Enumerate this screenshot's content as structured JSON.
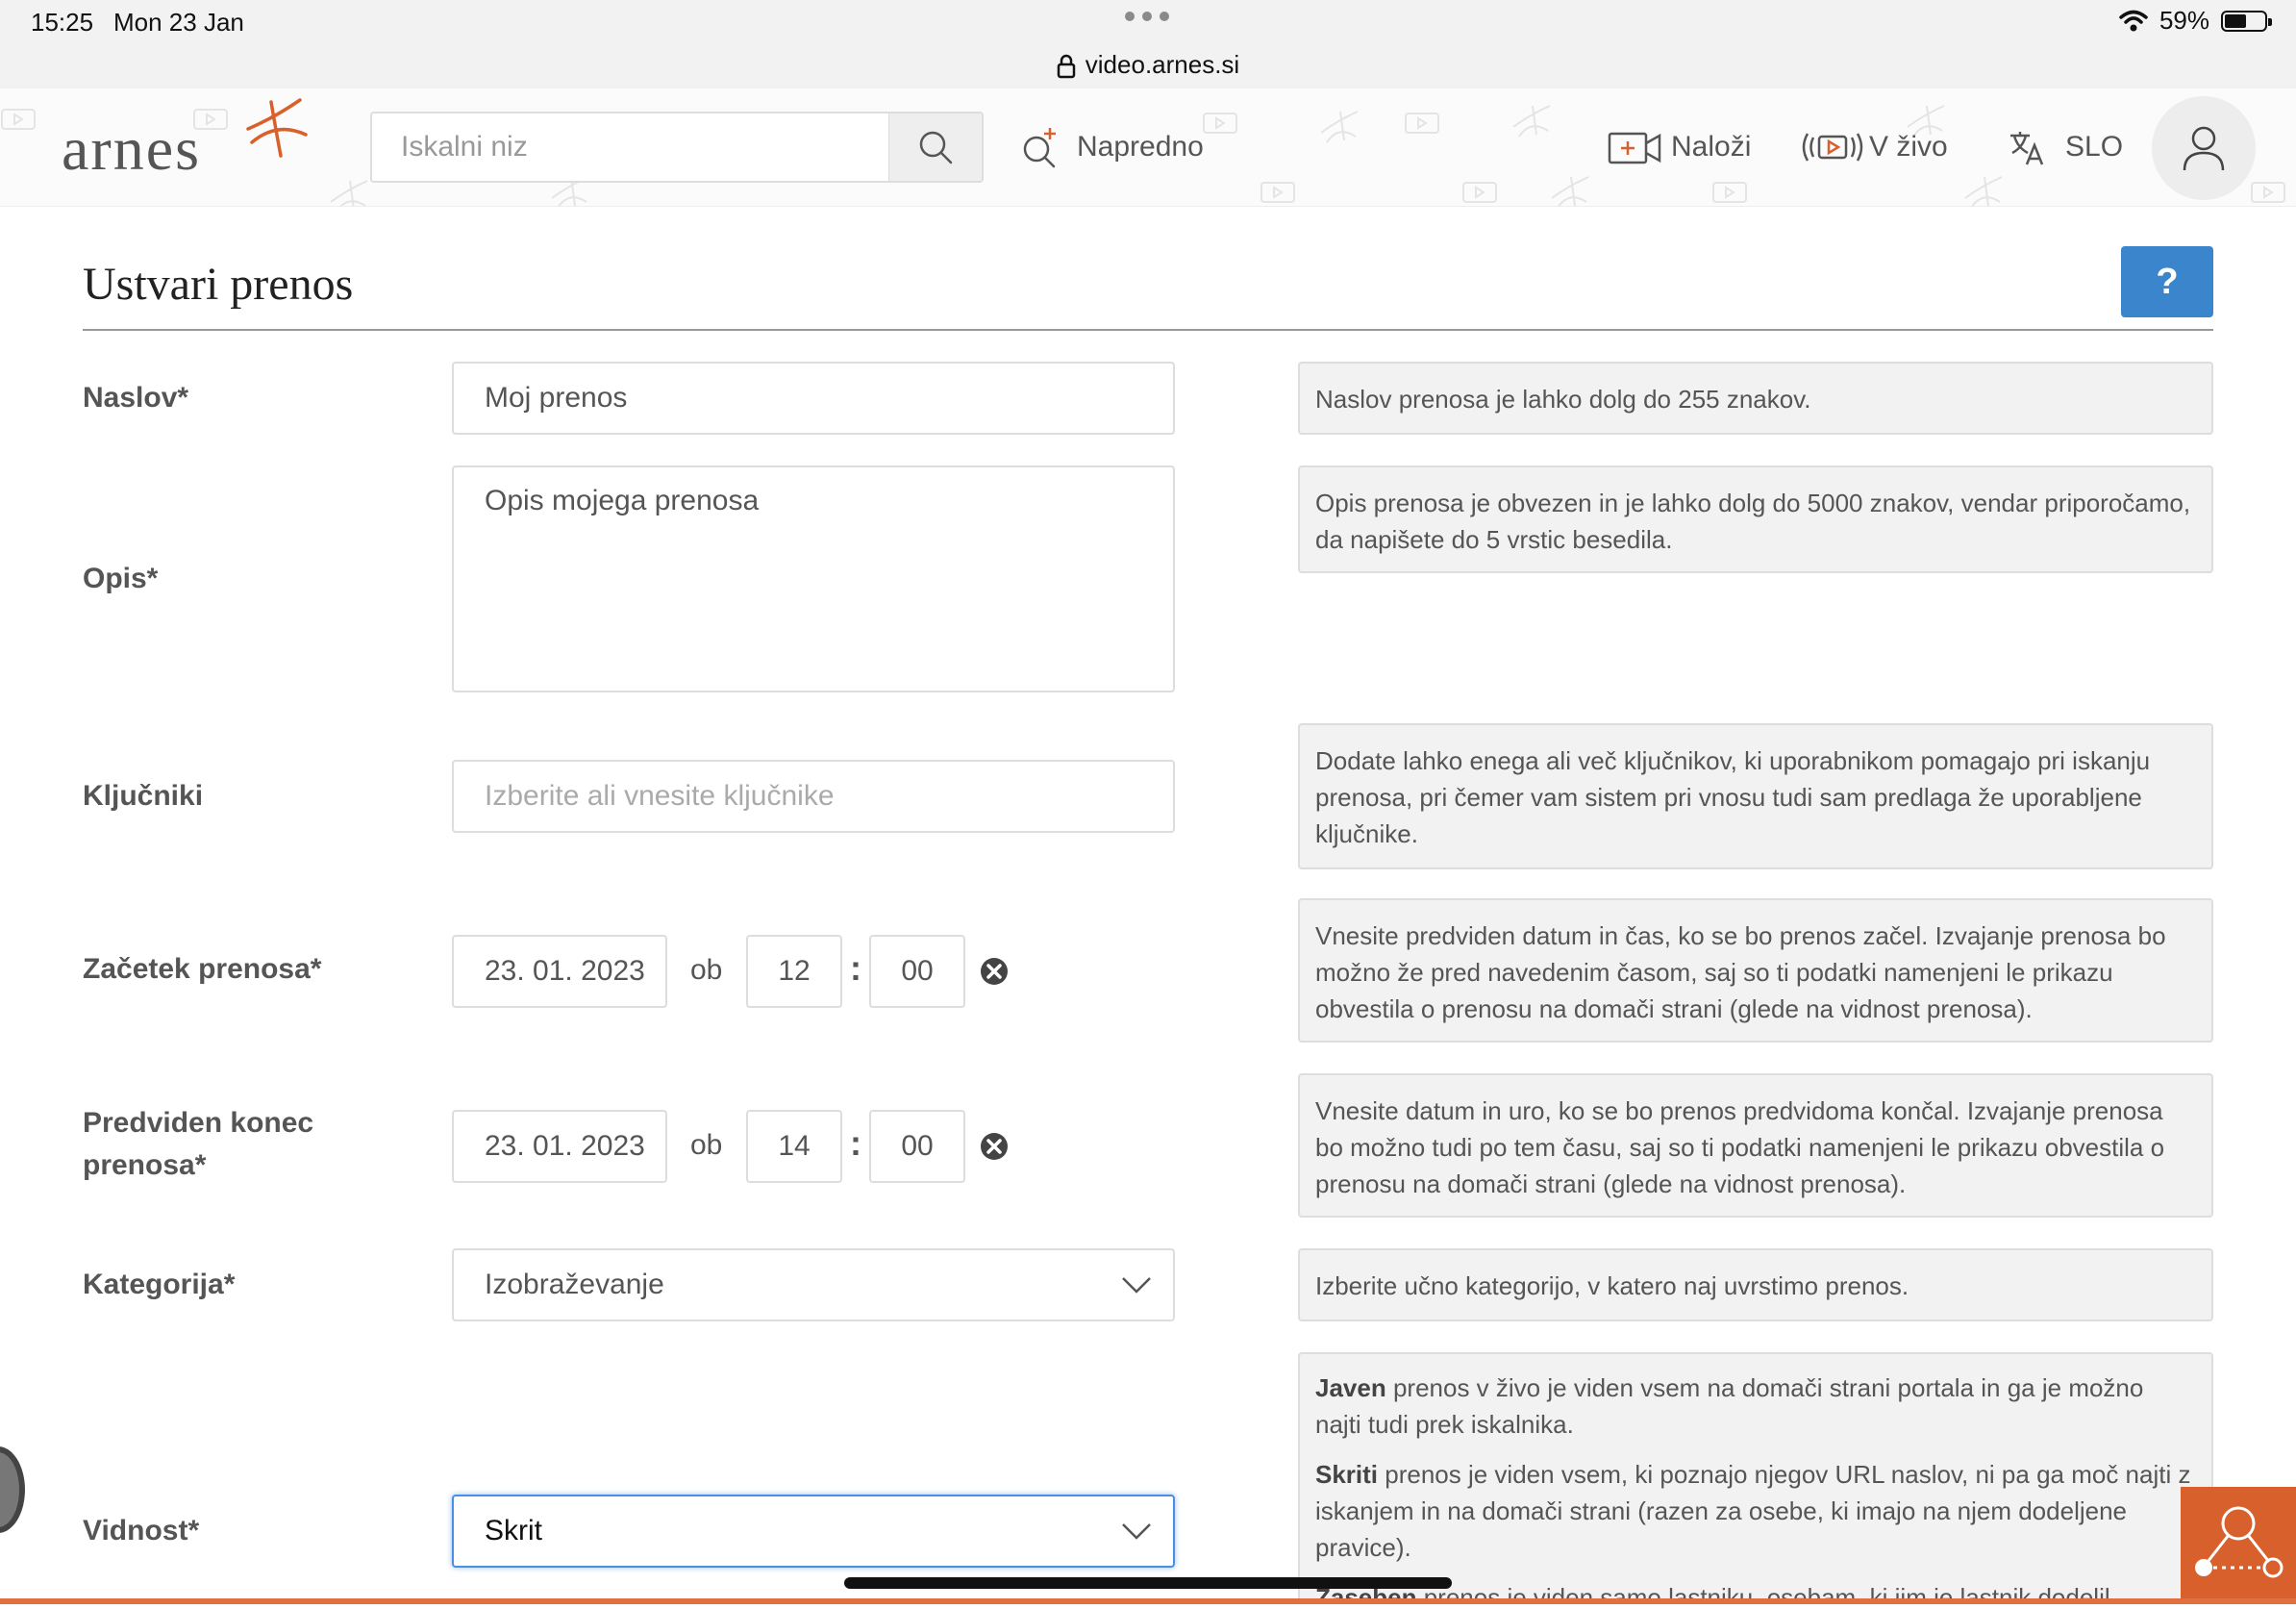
{
  "status_bar": {
    "time": "15:25",
    "date": "Mon 23 Jan",
    "battery": "59%",
    "battery_level": 0.59,
    "url": "video.arnes.si"
  },
  "header": {
    "logo_text": "arnes",
    "search_placeholder": "Iskalni niz",
    "advanced_label": "Napredno",
    "upload_label": "Naloži",
    "live_label": "V živo",
    "language_label": "SLO"
  },
  "page": {
    "title": "Ustvari prenos",
    "help_label": "?"
  },
  "form": {
    "title_field": {
      "label": "Naslov*",
      "value": "Moj prenos",
      "help": "Naslov prenosa je lahko dolg do 255 znakov."
    },
    "description": {
      "label": "Opis*",
      "value": "Opis mojega prenosa",
      "help": "Opis prenosa je obvezen in je lahko dolg do 5000 znakov, vendar priporočamo, da napišete do 5 vrstic besedila."
    },
    "keywords": {
      "label": "Ključniki",
      "placeholder": "Izberite ali vnesite ključnike",
      "help": "Dodate lahko enega ali več ključnikov, ki uporabnikom pomagajo pri iskanju prenosa, pri čemer vam sistem pri vnosu tudi sam predlaga že uporabljene ključnike."
    },
    "start": {
      "label": "Začetek prenosa*",
      "date": "23. 01. 2023",
      "at": "ob",
      "hour": "12",
      "separator": ":",
      "minute": "00",
      "help": "Vnesite predviden datum in čas, ko se bo prenos začel. Izvajanje prenosa bo možno že pred navedenim časom, saj so ti podatki namenjeni le prikazu obvestila o prenosu na domači strani (glede na vidnost prenosa)."
    },
    "end": {
      "label_line1": "Predviden konec",
      "label_line2": "prenosa*",
      "date": "23. 01. 2023",
      "at": "ob",
      "hour": "14",
      "separator": ":",
      "minute": "00",
      "help": "Vnesite datum in uro, ko se bo prenos predvidoma končal. Izvajanje prenosa bo možno tudi po tem času, saj so ti podatki namenjeni le prikazu obvestila o prenosu na domači strani (glede na vidnost prenosa)."
    },
    "category": {
      "label": "Kategorija*",
      "value": "Izobraževanje",
      "help": "Izberite učno kategorijo, v katero naj uvrstimo prenos."
    },
    "visibility": {
      "label": "Vidnost*",
      "value": "Skrit",
      "help_public_term": "Javen",
      "help_public_text": " prenos v živo je viden vsem na domači strani portala in ga je možno najti tudi prek iskalnika.",
      "help_hidden_term": "Skriti",
      "help_hidden_text": " prenos je viden vsem, ki poznajo njegov URL naslov, ni pa ga moč najti z iskanjem in na domači strani (razen za osebe, ki imajo na njem dodeljene pravice).",
      "help_private_term": "Zaseben",
      "help_private_text": " prenos je viden samo lastniku, osebam, ki jim je lastnik dodelil"
    }
  },
  "colors": {
    "accent_blue": "#3a85cc",
    "brand_orange": "#d8602c",
    "focus_blue": "#4a90e2"
  }
}
